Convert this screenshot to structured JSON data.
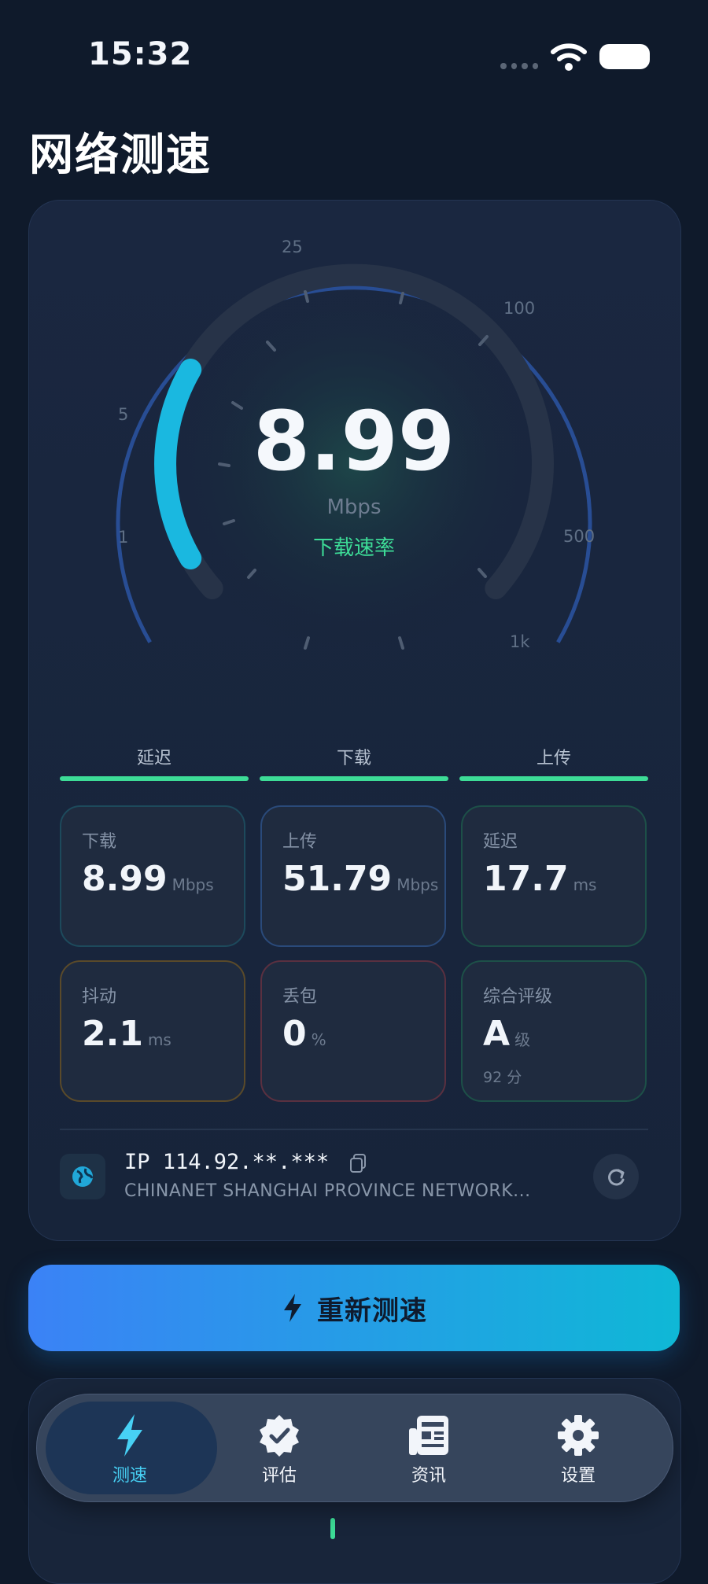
{
  "status_bar": {
    "time": "15:32"
  },
  "header": {
    "title": "网络测速"
  },
  "gauge": {
    "value": "8.99",
    "unit": "Mbps",
    "label": "下载速率",
    "tick_labels": [
      "1",
      "5",
      "25",
      "100",
      "500",
      "1k"
    ],
    "fill_fraction": 0.25,
    "accent_color": "#1ab8e0"
  },
  "phases": [
    {
      "label": "延迟"
    },
    {
      "label": "下载"
    },
    {
      "label": "上传"
    }
  ],
  "metrics": [
    {
      "label": "下载",
      "value": "8.99",
      "unit": "Mbps",
      "border": "#1d4a5c"
    },
    {
      "label": "上传",
      "value": "51.79",
      "unit": "Mbps",
      "border": "#2a4a7a"
    },
    {
      "label": "延迟",
      "value": "17.7",
      "unit": "ms",
      "border": "#1d5048"
    },
    {
      "label": "抖动",
      "value": "2.1",
      "unit": "ms",
      "border": "#5a4a2a"
    },
    {
      "label": "丢包",
      "value": "0",
      "unit": "%",
      "border": "#5a3040"
    },
    {
      "label": "综合评级",
      "value": "A",
      "unit": "级",
      "sub": "92 分",
      "border": "#1d5048"
    }
  ],
  "network": {
    "ip": "IP 114.92.**.***",
    "isp": "CHINANET SHANGHAI PROVINCE NETWORK..."
  },
  "actions": {
    "retest_label": "重新测速"
  },
  "nav": {
    "items": [
      {
        "label": "测速",
        "icon": "bolt-icon",
        "active": true
      },
      {
        "label": "评估",
        "icon": "verified-badge-icon"
      },
      {
        "label": "资讯",
        "icon": "newspaper-icon"
      },
      {
        "label": "设置",
        "icon": "gear-icon"
      }
    ]
  }
}
